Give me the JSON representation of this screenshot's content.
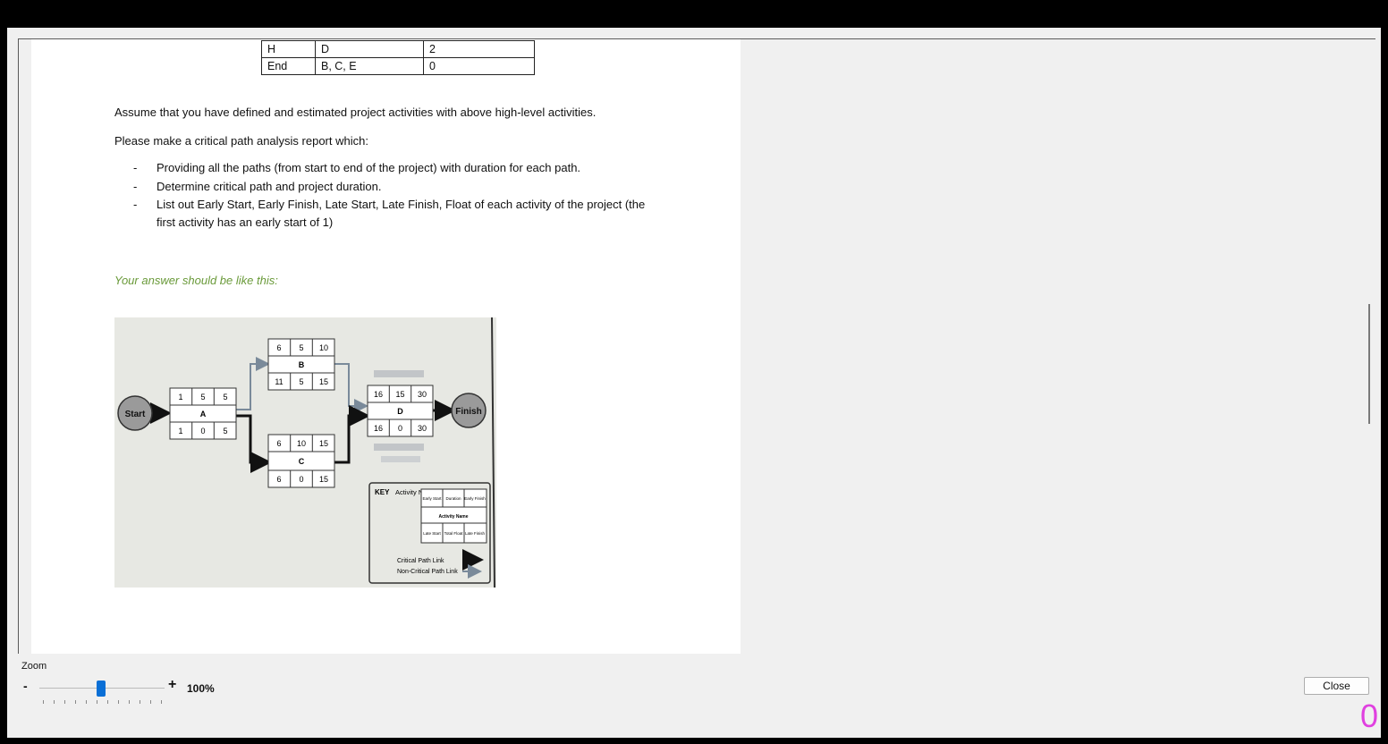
{
  "table_rows": [
    {
      "activity": "H",
      "predecessors": "D",
      "duration": "2"
    },
    {
      "activity": "End",
      "predecessors": "B, C, E",
      "duration": "0"
    }
  ],
  "paragraphs": {
    "p1": "Assume that you have defined and estimated project activities with above high-level activities.",
    "p2": "Please make a critical path analysis report which:"
  },
  "bullets": [
    "Providing all the paths (from start to end of the project) with duration for each path.",
    "Determine critical path and project duration.",
    "List out Early Start, Early Finish, Late Start, Late Finish, Float of each activity of the project (the first activity has an early start of 1)"
  ],
  "bullet_mark": "-",
  "answer_note": "Your answer should be like this:",
  "diagram": {
    "start": "Start",
    "finish": "Finish",
    "nodes": {
      "A": {
        "name": "A",
        "es": "1",
        "dur": "5",
        "ef": "5",
        "ls": "1",
        "fl": "0",
        "lf": "5"
      },
      "B": {
        "name": "B",
        "es": "6",
        "dur": "5",
        "ef": "10",
        "ls": "11",
        "fl": "5",
        "lf": "15"
      },
      "C": {
        "name": "C",
        "es": "6",
        "dur": "10",
        "ef": "15",
        "ls": "6",
        "fl": "0",
        "lf": "15"
      },
      "D": {
        "name": "D",
        "es": "16",
        "dur": "15",
        "ef": "30",
        "ls": "16",
        "fl": "0",
        "lf": "30"
      }
    },
    "key": {
      "title": "KEY",
      "node_label": "Activity Node",
      "early_start": "Early Start",
      "duration": "Duration",
      "early_finish": "Early Finish",
      "activity_name": "Activity Name",
      "late_start": "Late Start",
      "total_float": "Total Float",
      "late_finish": "Late Finish",
      "critical": "Critical Path Link",
      "noncritical": "Non-Critical Path Link"
    }
  },
  "zoom": {
    "label": "Zoom",
    "minus": "-",
    "plus": "+",
    "value": "100%",
    "level_fraction": 0.5
  },
  "close_label": "Close",
  "corner_glyph": "0",
  "colors": {
    "note_green": "#6a9a3a",
    "slider_blue": "#0a6fd6",
    "corner_magenta": "#e040e0"
  }
}
